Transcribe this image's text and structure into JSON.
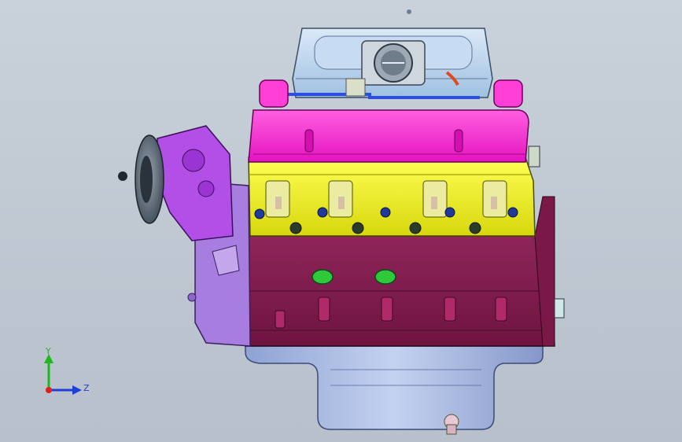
{
  "viewport": {
    "background_top": "#c9d1da",
    "background_bottom": "#b7c0cb"
  },
  "triad": {
    "y_label": "Y",
    "z_label": "Z",
    "colors": {
      "y": "#1fb81f",
      "z": "#1f3fd6",
      "origin": "#e01f1f"
    }
  },
  "model": {
    "name": "engine-assembly",
    "colors": {
      "intake_manifold": "#b9d4ef",
      "throttle_body": "#cfd7de",
      "valve_cover": "#ff2fd3",
      "cylinder_head": "#f2f21a",
      "engine_block": "#8a1e52",
      "oil_pan": "#9fb3df",
      "water_pump": "#b24fe6",
      "timing_cover": "#a77ee0",
      "pulley": "#5b6b7a",
      "bolt": "#1f3a9a",
      "fuel_rail": "#2a4fdf",
      "freeze_plug": "#2ec93a"
    }
  }
}
